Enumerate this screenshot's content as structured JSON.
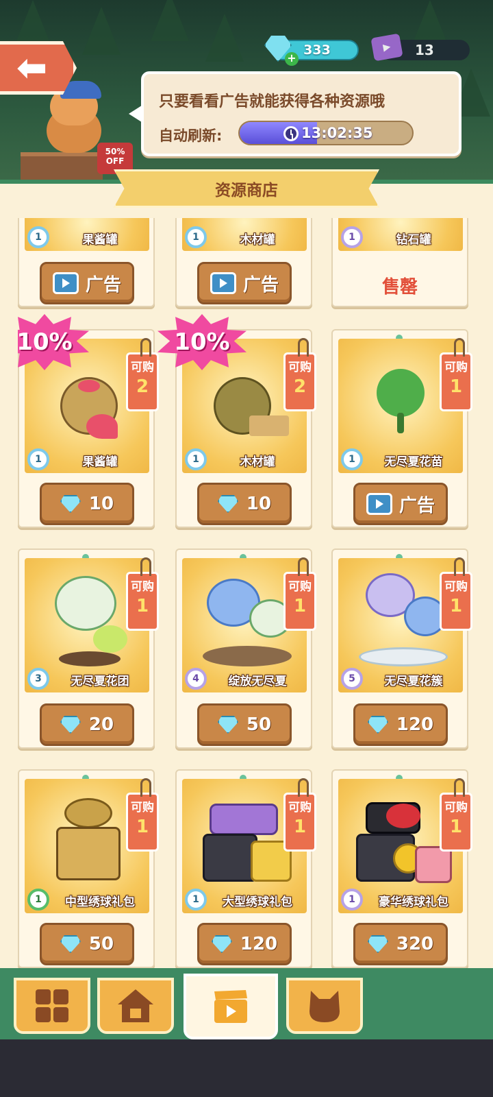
{
  "header": {
    "gems": "333",
    "tickets": "13",
    "sale_badge": "50% OFF",
    "bubble_message": "只要看看广告就能获得各种资源哦",
    "refresh_label": "自动刷新:",
    "refresh_timer": "13:02:35",
    "refresh_progress": 0.45
  },
  "shop": {
    "title": "资源商店",
    "available_label": "可购",
    "ad_label": "广告",
    "sold_out_label": "售罄",
    "discount": "10%",
    "row0": [
      {
        "name": "果酱罐",
        "level": "1",
        "action": "ad"
      },
      {
        "name": "木材罐",
        "level": "1",
        "action": "ad"
      },
      {
        "name": "钻石罐",
        "level": "1",
        "action": "soldout"
      }
    ],
    "row1": [
      {
        "name": "果酱罐",
        "level": "1",
        "qty": "2",
        "price": "10",
        "discount": true
      },
      {
        "name": "木材罐",
        "level": "1",
        "qty": "2",
        "price": "10",
        "discount": true
      },
      {
        "name": "无尽夏花苗",
        "level": "1",
        "qty": "1",
        "action": "ad"
      }
    ],
    "row2": [
      {
        "name": "无尽夏花团",
        "level": "3",
        "qty": "1",
        "price": "20"
      },
      {
        "name": "绽放无尽夏",
        "level": "4",
        "qty": "1",
        "price": "50"
      },
      {
        "name": "无尽夏花簇",
        "level": "5",
        "qty": "1",
        "price": "120"
      }
    ],
    "row3": [
      {
        "name": "中型绣球礼包",
        "level": "1",
        "qty": "1",
        "price": "50"
      },
      {
        "name": "大型绣球礼包",
        "level": "1",
        "qty": "1",
        "price": "120"
      },
      {
        "name": "豪华绣球礼包",
        "level": "1",
        "qty": "1",
        "price": "320"
      }
    ]
  },
  "nav": {
    "tabs": [
      "grid-icon",
      "house-icon",
      "clapper-icon",
      "cat-icon"
    ],
    "active": "clapper-icon"
  },
  "colors": {
    "accent_green": "#3e8a62",
    "tag_orange": "#ea6f4d",
    "button_brown": "#c98748",
    "burst_pink": "#f04aa0"
  }
}
